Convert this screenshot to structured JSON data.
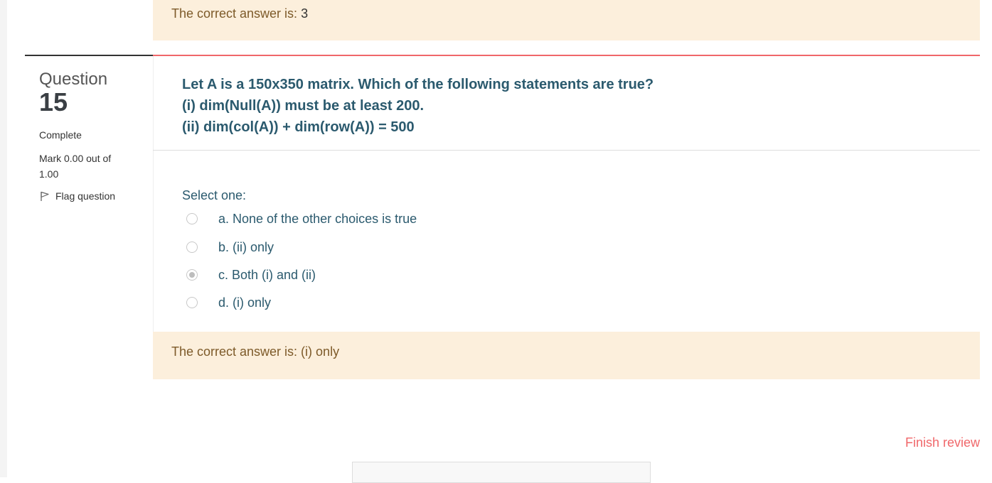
{
  "previous_question": {
    "feedback_label": "The correct answer is: ",
    "feedback_value": "3"
  },
  "question": {
    "word": "Question",
    "number": "15",
    "state": "Complete",
    "grade": "Mark 0.00 out of 1.00",
    "flag_label": "Flag question",
    "text_lines": [
      "Let A is a 150x350 matrix. Which of the following statements are true?",
      "(i) dim(Null(A)) must be at least 200.",
      "(ii) dim(col(A)) + dim(row(A)) = 500"
    ],
    "prompt": "Select one:",
    "answers": [
      {
        "label": "a. None of the other choices is true",
        "checked": false
      },
      {
        "label": "b. (ii) only",
        "checked": false
      },
      {
        "label": "c. Both (i) and (ii)",
        "checked": true
      },
      {
        "label": "d. (i) only",
        "checked": false
      }
    ],
    "feedback": "The correct answer is: (i) only"
  },
  "footer": {
    "finish_review": "Finish review"
  },
  "colors": {
    "feedback_bg": "#fcefdc",
    "accent": "#f0676a",
    "question_text": "#2b5a6e"
  },
  "icons": {
    "flag": "flag-icon"
  }
}
